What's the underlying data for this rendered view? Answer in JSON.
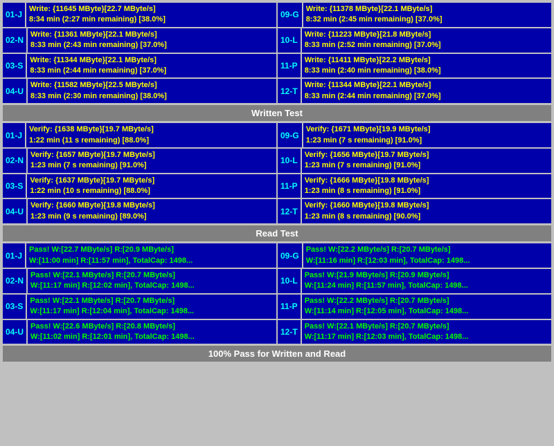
{
  "sections": {
    "write_header": "Written Test",
    "read_header": "Read Test",
    "footer": "100% Pass for Written and Read"
  },
  "write_rows": [
    {
      "left": {
        "id": "01-J",
        "line1": "Write: {11645 MByte}[22.7 MByte/s]",
        "line2": "8:34 min (2:27 min remaining)  [38.0%]"
      },
      "right": {
        "id": "09-G",
        "line1": "Write: {11378 MByte}[22.1 MByte/s]",
        "line2": "8:32 min (2:45 min remaining)  [37.0%]"
      }
    },
    {
      "left": {
        "id": "02-N",
        "line1": "Write: {11361 MByte}[22.1 MByte/s]",
        "line2": "8:33 min (2:43 min remaining)  [37.0%]"
      },
      "right": {
        "id": "10-L",
        "line1": "Write: {11223 MByte}[21.8 MByte/s]",
        "line2": "8:33 min (2:52 min remaining)  [37.0%]"
      }
    },
    {
      "left": {
        "id": "03-S",
        "line1": "Write: {11344 MByte}[22.1 MByte/s]",
        "line2": "8:33 min (2:44 min remaining)  [37.0%]"
      },
      "right": {
        "id": "11-P",
        "line1": "Write: {11411 MByte}[22.2 MByte/s]",
        "line2": "8:33 min (2:40 min remaining)  [38.0%]"
      }
    },
    {
      "left": {
        "id": "04-U",
        "line1": "Write: {11582 MByte}[22.5 MByte/s]",
        "line2": "8:33 min (2:30 min remaining)  [38.0%]"
      },
      "right": {
        "id": "12-T",
        "line1": "Write: {11344 MByte}[22.1 MByte/s]",
        "line2": "8:33 min (2:44 min remaining)  [37.0%]"
      }
    }
  ],
  "verify_rows": [
    {
      "left": {
        "id": "01-J",
        "line1": "Verify: {1638 MByte}[19.7 MByte/s]",
        "line2": "1:22 min (11 s remaining)  [88.0%]"
      },
      "right": {
        "id": "09-G",
        "line1": "Verify: {1671 MByte}[19.9 MByte/s]",
        "line2": "1:23 min (7 s remaining)  [91.0%]"
      }
    },
    {
      "left": {
        "id": "02-N",
        "line1": "Verify: {1657 MByte}[19.7 MByte/s]",
        "line2": "1:23 min (7 s remaining)  [91.0%]"
      },
      "right": {
        "id": "10-L",
        "line1": "Verify: {1656 MByte}[19.7 MByte/s]",
        "line2": "1:23 min (7 s remaining)  [91.0%]"
      }
    },
    {
      "left": {
        "id": "03-S",
        "line1": "Verify: {1637 MByte}[19.7 MByte/s]",
        "line2": "1:22 min (10 s remaining)  [88.0%]"
      },
      "right": {
        "id": "11-P",
        "line1": "Verify: {1666 MByte}[19.8 MByte/s]",
        "line2": "1:23 min (8 s remaining)  [91.0%]"
      }
    },
    {
      "left": {
        "id": "04-U",
        "line1": "Verify: {1660 MByte}[19.8 MByte/s]",
        "line2": "1:23 min (9 s remaining)  [89.0%]"
      },
      "right": {
        "id": "12-T",
        "line1": "Verify: {1660 MByte}[19.8 MByte/s]",
        "line2": "1:23 min (8 s remaining)  [90.0%]"
      }
    }
  ],
  "pass_rows": [
    {
      "left": {
        "id": "01-J",
        "line1": "Pass! W:[22.7 MByte/s] R:[20.9 MByte/s]",
        "line2": "W:[11:00 min] R:[11:57 min], TotalCap: 1498..."
      },
      "right": {
        "id": "09-G",
        "line1": "Pass! W:[22.2 MByte/s] R:[20.7 MByte/s]",
        "line2": "W:[11:16 min] R:[12:03 min], TotalCap: 1498..."
      }
    },
    {
      "left": {
        "id": "02-N",
        "line1": "Pass! W:[22.1 MByte/s] R:[20.7 MByte/s]",
        "line2": "W:[11:17 min] R:[12:02 min], TotalCap: 1498..."
      },
      "right": {
        "id": "10-L",
        "line1": "Pass! W:[21.9 MByte/s] R:[20.9 MByte/s]",
        "line2": "W:[11:24 min] R:[11:57 min], TotalCap: 1498..."
      }
    },
    {
      "left": {
        "id": "03-S",
        "line1": "Pass! W:[22.1 MByte/s] R:[20.7 MByte/s]",
        "line2": "W:[11:17 min] R:[12:04 min], TotalCap: 1498..."
      },
      "right": {
        "id": "11-P",
        "line1": "Pass! W:[22.2 MByte/s] R:[20.7 MByte/s]",
        "line2": "W:[11:14 min] R:[12:05 min], TotalCap: 1498..."
      }
    },
    {
      "left": {
        "id": "04-U",
        "line1": "Pass! W:[22.6 MByte/s] R:[20.8 MByte/s]",
        "line2": "W:[11:02 min] R:[12:01 min], TotalCap: 1498..."
      },
      "right": {
        "id": "12-T",
        "line1": "Pass! W:[22.1 MByte/s] R:[20.7 MByte/s]",
        "line2": "W:[11:17 min] R:[12:03 min], TotalCap: 1498..."
      }
    }
  ]
}
